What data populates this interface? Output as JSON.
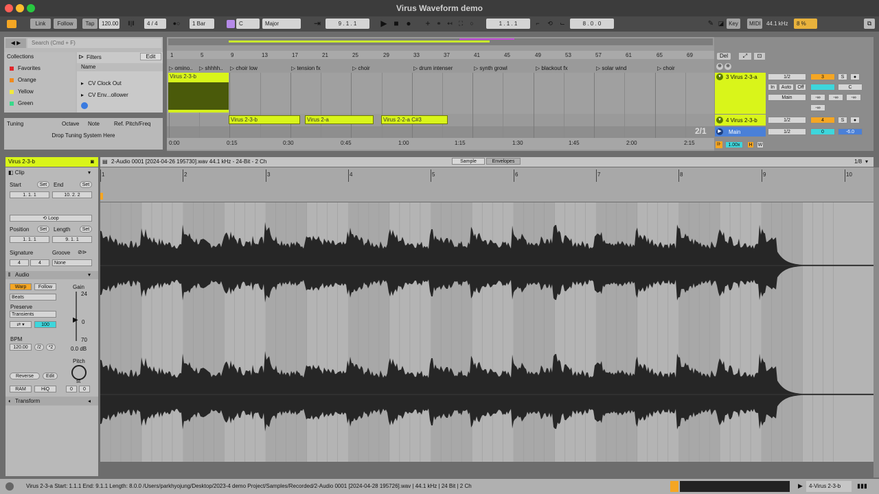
{
  "window": {
    "title": "Virus Waveform demo"
  },
  "control_bar": {
    "link": "Link",
    "follow": "Follow",
    "tap": "Tap",
    "tempo": "120.00",
    "signature": "4 / 4",
    "metronome_sync": "1 Bar",
    "key": "C",
    "scale": "Major",
    "position": "9 .   1 .   1",
    "loop_start": "1 .   1 .   1",
    "loop_length": "8 .   0 .   0",
    "key_label": "Key",
    "midi_label": "MIDI",
    "sample_rate": "44.1 kHz",
    "cpu": "8 %",
    "icon_names": [
      "metronome-icon",
      "play-icon",
      "stop-icon",
      "record-icon",
      "pencil-icon",
      "draw-mode-icon"
    ]
  },
  "browser": {
    "search_placeholder": "Search (Cmd + F)",
    "collections_header": "Collections",
    "filters_label": "Filters",
    "edit_label": "Edit",
    "name_column": "Name",
    "collections": [
      {
        "label": "Favorites",
        "color": "#e0262a"
      },
      {
        "label": "Orange",
        "color": "#f08a1c"
      },
      {
        "label": "Yellow",
        "color": "#f1e83c"
      },
      {
        "label": "Green",
        "color": "#39d98a"
      }
    ],
    "items": [
      "CV Clock Out",
      "CV Env...ollower"
    ]
  },
  "tuning": {
    "title": "Tuning",
    "col_octave": "Octave",
    "col_note": "Note",
    "col_ref": "Ref. Pitch/Freq",
    "drop_hint": "Drop Tuning System Here"
  },
  "arrangement": {
    "bar_numbers": [
      "1",
      "5",
      "9",
      "13",
      "17",
      "21",
      "25",
      "29",
      "33",
      "37",
      "41",
      "45",
      "49",
      "53",
      "57",
      "61",
      "65",
      "69"
    ],
    "markers": [
      "omino..",
      "shhhh..",
      "choir low",
      "tension fx",
      "choir",
      "drum intenser",
      "synth growl",
      "blackout fx",
      "solar wind",
      "choir"
    ],
    "time_labels": [
      "0:00",
      "0:15",
      "0:30",
      "0:45",
      "1:00",
      "1:15",
      "1:30",
      "1:45",
      "2:00",
      "2:15"
    ],
    "clips": [
      "Virus 2-3-b",
      "Virus 2-3-b",
      "Virus 2-a",
      "Virus 2-2-a C#3"
    ],
    "overview_ratio": "2/1",
    "del_label": "Del"
  },
  "tracks": [
    {
      "name": "3 Virus 2-3-a",
      "quant": "1/2",
      "number": "3",
      "solo": "S",
      "pan": "C",
      "input": "In",
      "auto": "Auto",
      "off": "Off",
      "route": "Main",
      "vol": "-∞"
    },
    {
      "name": "4 Virus 2-3-b",
      "quant": "1/2",
      "number": "4",
      "solo": "S"
    },
    {
      "name": "Main",
      "quant": "1/2",
      "vol": "0",
      "db": "-6.0"
    }
  ],
  "mixer_footer": {
    "zoom": "1.00x",
    "h": "H",
    "w": "W"
  },
  "clip_view": {
    "clip_name": "Virus 2-3-b",
    "clip_section": "Clip",
    "start_label": "Start",
    "end_label": "End",
    "set": "Set",
    "start_value": "1.   1.   1",
    "end_value": "10.   2.   2",
    "loop": "Loop",
    "position_label": "Position",
    "length_label": "Length",
    "position_value": "1.   1.   1",
    "length_value": "9.   1.   1",
    "signature_label": "Signature",
    "groove_label": "Groove",
    "sig_num": "4",
    "sig_den": "4",
    "groove_value": "None",
    "audio_section": "Audio",
    "warp": "Warp",
    "follow": "Follow",
    "warp_mode": "Beats",
    "preserve_label": "Preserve",
    "preserve_value": "Transients",
    "loop_mode_value": "100",
    "bpm_label": "BPM",
    "bpm_value": "120.00",
    "half": "/2",
    "double": "*2",
    "gain_label": "Gain",
    "gain_top": "24",
    "gain_mid": "0",
    "gain_bottom": "70",
    "gain_value": "0.0 dB",
    "pitch_label": "Pitch",
    "pitch_unit": "st",
    "pitch_a": "0",
    "pitch_b": "0",
    "reverse": "Reverse",
    "edit": "Edit",
    "ram": "RAM",
    "hiq": "HiQ",
    "transform": "Transform"
  },
  "sample_editor": {
    "file_info": "2-Audio 0001 [2024-04-26 195730].wav  44.1 kHz - 24-Bit - 2 Ch",
    "tab_sample": "Sample",
    "tab_envelopes": "Envelopes",
    "grid": "1/8",
    "bars": [
      "1",
      "2",
      "3",
      "4",
      "5",
      "6",
      "7",
      "8",
      "9",
      "10"
    ]
  },
  "status_bar": {
    "text": "Virus 2-3-a  Start: 1.1.1  End: 9.1.1  Length: 8.0.0  /Users/parkhyojung/Desktop/2023-4 demo Project/Samples/Recorded/2-Audio 0001 [2024-04-28 195726].wav | 44.1 kHz | 24 Bit | 2 Ch",
    "track": "4-Virus 2-3-b"
  }
}
